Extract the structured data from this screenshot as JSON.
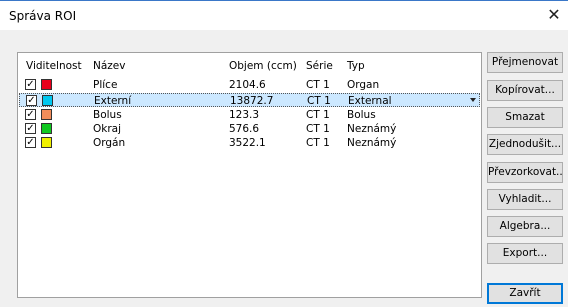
{
  "window": {
    "title": "Správa ROI",
    "close_glyph": "✕"
  },
  "table": {
    "headers": {
      "visibility": "Viditelnost",
      "name": "Název",
      "volume": "Objem (ccm)",
      "series": "Série",
      "type": "Typ"
    },
    "rows": [
      {
        "checked": true,
        "color": "#e8001c",
        "name": "Plíce",
        "volume": "2104.6",
        "series": "CT 1",
        "type": "Organ",
        "selected": false
      },
      {
        "checked": true,
        "color": "#00c8f0",
        "name": "Externí",
        "volume": "13872.7",
        "series": "CT 1",
        "type": "External",
        "selected": true
      },
      {
        "checked": true,
        "color": "#f08c5a",
        "name": "Bolus",
        "volume": "123.3",
        "series": "CT 1",
        "type": "Bolus",
        "selected": false
      },
      {
        "checked": true,
        "color": "#10c820",
        "name": "Okraj",
        "volume": "576.6",
        "series": "CT 1",
        "type": "Neznámý",
        "selected": false
      },
      {
        "checked": true,
        "color": "#f0f000",
        "name": "Orgán",
        "volume": "3522.1",
        "series": "CT 1",
        "type": "Neznámý",
        "selected": false
      }
    ]
  },
  "buttons": {
    "rename": "Přejmenovat",
    "copy": "Kopírovat...",
    "delete": "Smazat",
    "simplify": "Zjednodušit...",
    "resample": "Převzorkovat...",
    "smooth": "Vyhladit...",
    "algebra": "Algebra...",
    "export": "Export...",
    "close": "Zavřít"
  }
}
